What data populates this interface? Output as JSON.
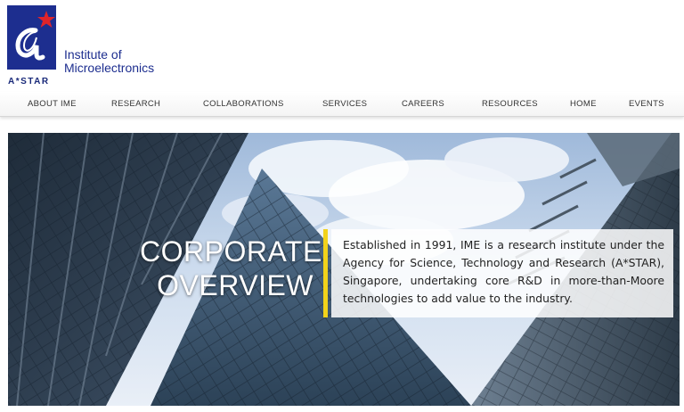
{
  "brand": {
    "logo_mark": "a*",
    "logo_caption": "A*STAR",
    "name_line1": "Institute of",
    "name_line2": "Microelectronics",
    "colors": {
      "logo_blue": "#1d2e8f",
      "star_red": "#e0242a"
    }
  },
  "nav": {
    "items": [
      {
        "label": "ABOUT IME"
      },
      {
        "label": "RESEARCH"
      },
      {
        "label": "COLLABORATIONS"
      },
      {
        "label": "SERVICES"
      },
      {
        "label": "CAREERS"
      },
      {
        "label": "RESOURCES"
      },
      {
        "label": "HOME"
      },
      {
        "label": "EVENTS"
      }
    ]
  },
  "hero": {
    "title_line1": "CORPORATE",
    "title_line2": "OVERVIEW",
    "description": "Established in 1991, IME is a research institute under the Agency for Science, Technology and Research (A*STAR), Singapore, undertaking core R&D in more-than-Moore technologies to add value to the industry.",
    "accent_color": "#f2d21a"
  }
}
